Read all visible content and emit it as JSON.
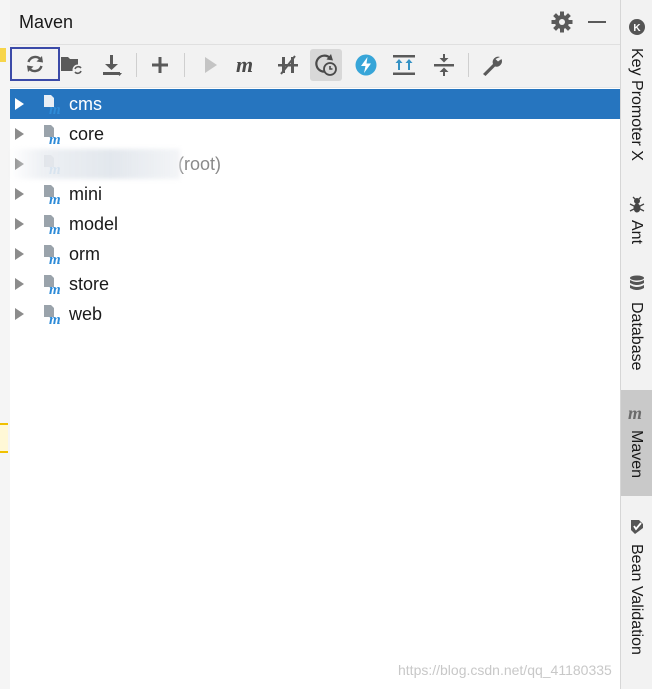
{
  "panel": {
    "title": "Maven",
    "header_icons": [
      "gear-icon",
      "minimize-icon"
    ]
  },
  "toolbar": {
    "buttons": [
      {
        "name": "reload-all-projects-button",
        "icon": "refresh-icon"
      },
      {
        "name": "generate-sources-button",
        "icon": "folder-refresh-icon"
      },
      {
        "name": "download-sources-button",
        "icon": "download-icon"
      },
      {
        "name": "add-project-button",
        "icon": "plus-icon"
      },
      {
        "name": "run-button",
        "icon": "play-icon"
      },
      {
        "name": "execute-goal-button",
        "icon": "maven-m-icon"
      },
      {
        "name": "toggle-offline-button",
        "icon": "offline-icon"
      },
      {
        "name": "skip-tests-button",
        "icon": "clock-refresh-icon"
      },
      {
        "name": "show-dependencies-button",
        "icon": "lightning-icon"
      },
      {
        "name": "expand-all-button",
        "icon": "expand-all-icon"
      },
      {
        "name": "collapse-all-button",
        "icon": "collapse-all-icon"
      },
      {
        "name": "settings-button",
        "icon": "wrench-icon"
      }
    ]
  },
  "tree": {
    "items": [
      {
        "label": "cms",
        "suffix": "",
        "selected": true
      },
      {
        "label": "core",
        "suffix": "",
        "selected": false
      },
      {
        "label": "",
        "suffix": "(root)",
        "selected": false,
        "obscured": true
      },
      {
        "label": "mini",
        "suffix": "",
        "selected": false
      },
      {
        "label": "model",
        "suffix": "",
        "selected": false
      },
      {
        "label": "orm",
        "suffix": "",
        "selected": false
      },
      {
        "label": "store",
        "suffix": "",
        "selected": false
      },
      {
        "label": "web",
        "suffix": "",
        "selected": false
      }
    ]
  },
  "side_tabs": [
    {
      "label": "Key Promoter X",
      "icon": "key-promoter-icon",
      "active": false
    },
    {
      "label": "Ant",
      "icon": "ant-icon",
      "active": false
    },
    {
      "label": "Database",
      "icon": "database-icon",
      "active": false
    },
    {
      "label": "Maven",
      "icon": "maven-m-icon",
      "active": true
    },
    {
      "label": "Bean Validation",
      "icon": "bean-validation-icon",
      "active": false
    }
  ],
  "colors": {
    "selection": "#2675bf",
    "focus_border": "#3b4aa8",
    "maven_icon_blue": "#2d8bd8"
  },
  "watermark": "https://blog.csdn.net/qq_41180335"
}
